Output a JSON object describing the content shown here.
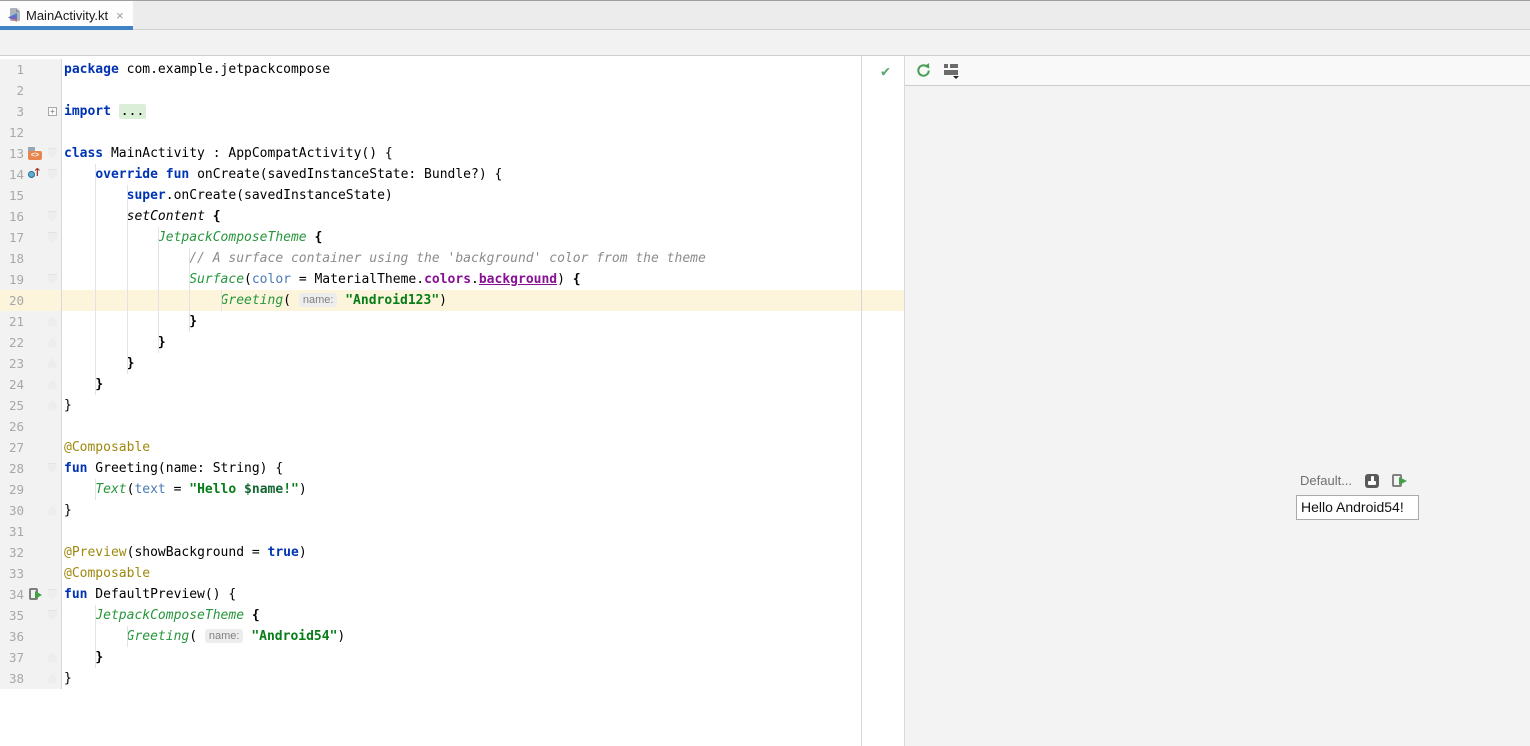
{
  "tab_bar": {
    "tabs": [
      {
        "label": "MainActivity.kt",
        "active": true,
        "close_label": "×",
        "icon": "kotlin-file-icon"
      }
    ]
  },
  "editor": {
    "status_check": "✔",
    "margin_column": 100,
    "colors": {
      "keyword": "#0033B3",
      "string": "#067D17",
      "composable": "#27963C",
      "annotation": "#9E880D",
      "property": "#871094",
      "parameter": "#4A7AB8",
      "comment": "#8C8C8C",
      "current_line": "#FCF5DC",
      "tab_accent": "#4083C4",
      "gutter_bg": "#F2F2F2",
      "pane_bg": "#F3F3F3"
    },
    "lines": [
      {
        "n": 1,
        "tok": [
          [
            "kw",
            "package"
          ],
          [
            "pl",
            " com.example.jetpackcompose"
          ]
        ]
      },
      {
        "n": 2,
        "tok": []
      },
      {
        "n": 3,
        "fold": "plus",
        "tok": [
          [
            "kw",
            "import"
          ],
          [
            "pl",
            " "
          ],
          [
            "fold",
            "..."
          ]
        ]
      },
      {
        "n": 12,
        "tok": []
      },
      {
        "n": 13,
        "icon": "layout",
        "fold": "start",
        "tok": [
          [
            "kw",
            "class"
          ],
          [
            "pl",
            " MainActivity : AppCompatActivity() {"
          ]
        ]
      },
      {
        "n": 14,
        "icon": "override",
        "fold": "start",
        "tok": [
          [
            "pl",
            "    "
          ],
          [
            "kw",
            "override"
          ],
          [
            "pl",
            " "
          ],
          [
            "kw",
            "fun"
          ],
          [
            "pl",
            " onCreate(savedInstanceState: Bundle?) {"
          ]
        ]
      },
      {
        "n": 15,
        "tok": [
          [
            "pl",
            "        "
          ],
          [
            "kw",
            "super"
          ],
          [
            "pl",
            ".onCreate(savedInstanceState)"
          ]
        ]
      },
      {
        "n": 16,
        "fold": "start",
        "tok": [
          [
            "pl",
            "        "
          ],
          [
            "decl",
            "setContent"
          ],
          [
            "pl",
            " "
          ],
          [
            "br",
            "{"
          ]
        ]
      },
      {
        "n": 17,
        "fold": "start",
        "tok": [
          [
            "pl",
            "            "
          ],
          [
            "comp",
            "JetpackComposeTheme"
          ],
          [
            "pl",
            " "
          ],
          [
            "br",
            "{"
          ]
        ]
      },
      {
        "n": 18,
        "tok": [
          [
            "pl",
            "                "
          ],
          [
            "cm",
            "// A surface container using the 'background' color from the theme"
          ]
        ]
      },
      {
        "n": 19,
        "fold": "start",
        "tok": [
          [
            "pl",
            "                "
          ],
          [
            "comp",
            "Surface"
          ],
          [
            "pl",
            "("
          ],
          [
            "par",
            "color"
          ],
          [
            "pl",
            " = MaterialTheme."
          ],
          [
            "prop",
            "colors"
          ],
          [
            "pl",
            "."
          ],
          [
            "propu",
            "background"
          ],
          [
            "pl",
            ") "
          ],
          [
            "br",
            "{"
          ]
        ]
      },
      {
        "n": 20,
        "hl": true,
        "tok": [
          [
            "pl",
            "                    "
          ],
          [
            "comp",
            "Greeting"
          ],
          [
            "pl",
            "( "
          ],
          [
            "inlay",
            "name:"
          ],
          [
            "pl",
            " "
          ],
          [
            "str",
            "\"Android123\""
          ],
          [
            "pl",
            ")"
          ]
        ]
      },
      {
        "n": 21,
        "fold": "end",
        "tok": [
          [
            "pl",
            "                "
          ],
          [
            "br",
            "}"
          ]
        ]
      },
      {
        "n": 22,
        "fold": "end",
        "tok": [
          [
            "pl",
            "            "
          ],
          [
            "br",
            "}"
          ]
        ]
      },
      {
        "n": 23,
        "fold": "end",
        "tok": [
          [
            "pl",
            "        "
          ],
          [
            "br",
            "}"
          ]
        ]
      },
      {
        "n": 24,
        "fold": "end",
        "tok": [
          [
            "pl",
            "    "
          ],
          [
            "br",
            "}"
          ]
        ]
      },
      {
        "n": 25,
        "fold": "end",
        "tok": [
          [
            "pl",
            "}"
          ]
        ]
      },
      {
        "n": 26,
        "tok": []
      },
      {
        "n": 27,
        "tok": [
          [
            "ann",
            "@Composable"
          ]
        ]
      },
      {
        "n": 28,
        "fold": "start",
        "tok": [
          [
            "kw",
            "fun"
          ],
          [
            "pl",
            " Greeting(name: String) {"
          ]
        ]
      },
      {
        "n": 29,
        "tok": [
          [
            "pl",
            "    "
          ],
          [
            "comp",
            "Text"
          ],
          [
            "pl",
            "("
          ],
          [
            "par",
            "text"
          ],
          [
            "pl",
            " = "
          ],
          [
            "str",
            "\"Hello "
          ],
          [
            "tmpl",
            "$name"
          ],
          [
            "str",
            "!\""
          ],
          [
            "pl",
            ")"
          ]
        ]
      },
      {
        "n": 30,
        "fold": "end",
        "tok": [
          [
            "pl",
            "}"
          ]
        ]
      },
      {
        "n": 31,
        "tok": []
      },
      {
        "n": 32,
        "tok": [
          [
            "ann",
            "@Preview"
          ],
          [
            "pl",
            "(showBackground = "
          ],
          [
            "kw",
            "true"
          ],
          [
            "pl",
            ")"
          ]
        ]
      },
      {
        "n": 33,
        "tok": [
          [
            "ann",
            "@Composable"
          ]
        ]
      },
      {
        "n": 34,
        "icon": "run",
        "fold": "start",
        "tok": [
          [
            "kw",
            "fun"
          ],
          [
            "pl",
            " DefaultPreview() {"
          ]
        ]
      },
      {
        "n": 35,
        "fold": "start",
        "tok": [
          [
            "pl",
            "    "
          ],
          [
            "comp",
            "JetpackComposeTheme"
          ],
          [
            "pl",
            " "
          ],
          [
            "br",
            "{"
          ]
        ]
      },
      {
        "n": 36,
        "tok": [
          [
            "pl",
            "        "
          ],
          [
            "comp",
            "Greeting"
          ],
          [
            "pl",
            "( "
          ],
          [
            "inlay",
            "name:"
          ],
          [
            "pl",
            " "
          ],
          [
            "str",
            "\"Android54\""
          ],
          [
            "pl",
            ")"
          ]
        ]
      },
      {
        "n": 37,
        "fold": "end",
        "tok": [
          [
            "pl",
            "    "
          ],
          [
            "br",
            "}"
          ]
        ]
      },
      {
        "n": 38,
        "fold": "end",
        "tok": [
          [
            "pl",
            "}"
          ]
        ]
      }
    ]
  },
  "preview_pane": {
    "toolbar": {
      "refresh_icon": "build-refresh-icon",
      "view_options_icon": "layout-options-icon"
    },
    "preview": {
      "name_label": "Default...",
      "interactive_icon": "interactive-preview-icon",
      "run_icon": "run-preview-icon",
      "rendered_text": "Hello Android54!"
    }
  }
}
